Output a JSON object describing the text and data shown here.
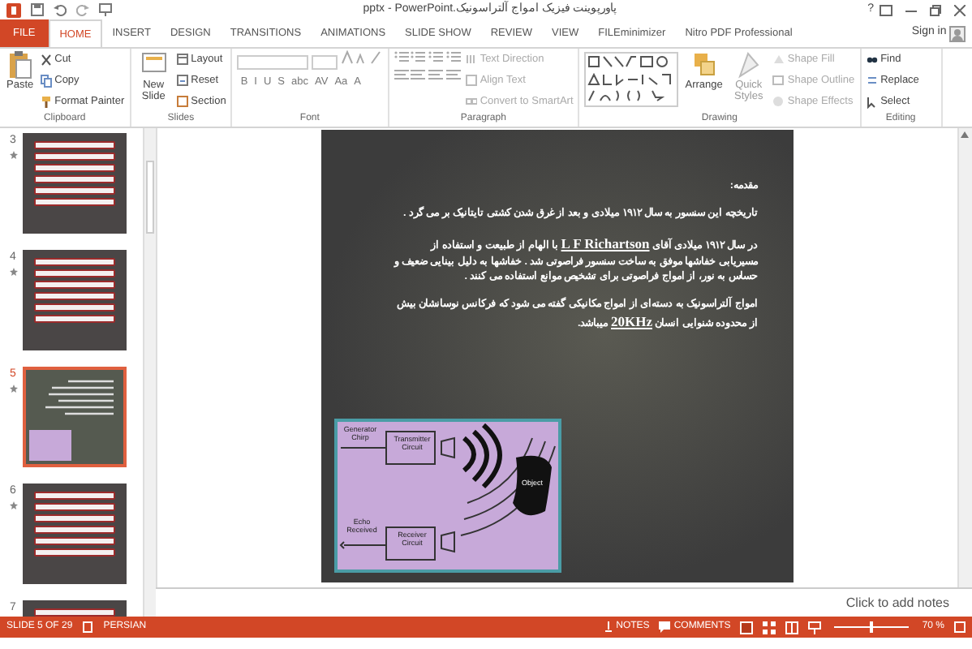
{
  "window": {
    "title": "پاورپوینت فیزیک امواج آلتراسونیک.pptx - PowerPoint",
    "help": "?"
  },
  "tabs": [
    {
      "label": "FILE",
      "kind": "file",
      "selected": false
    },
    {
      "label": "HOME",
      "kind": "tab",
      "selected": true
    },
    {
      "label": "INSERT",
      "kind": "tab",
      "selected": false
    },
    {
      "label": "DESIGN",
      "kind": "tab",
      "selected": false
    },
    {
      "label": "TRANSITIONS",
      "kind": "tab",
      "selected": false
    },
    {
      "label": "ANIMATIONS",
      "kind": "tab",
      "selected": false
    },
    {
      "label": "SLIDE SHOW",
      "kind": "tab",
      "selected": false
    },
    {
      "label": "REVIEW",
      "kind": "tab",
      "selected": false
    },
    {
      "label": "VIEW",
      "kind": "tab",
      "selected": false
    },
    {
      "label": "FILEminimizer",
      "kind": "tab",
      "selected": false
    },
    {
      "label": "Nitro PDF Professional",
      "kind": "tab",
      "selected": false
    }
  ],
  "sign_in": "Sign in",
  "ribbon": [
    {
      "name": "Clipboard",
      "kind": "clipboard",
      "big": [
        {
          "label": "Paste"
        }
      ],
      "items": [
        {
          "label": "Cut",
          "disabled": false
        },
        {
          "label": "Copy",
          "disabled": false
        },
        {
          "label": "Format Painter",
          "disabled": false
        }
      ]
    },
    {
      "name": "Slides",
      "kind": "slides",
      "big": [
        {
          "label": "New Slide"
        }
      ],
      "items": [
        {
          "label": "Layout",
          "disabled": false
        },
        {
          "label": "Reset",
          "disabled": false
        },
        {
          "label": "Section",
          "disabled": false
        }
      ]
    },
    {
      "name": "Font",
      "kind": "font",
      "buttons": [
        "B",
        "I",
        "U",
        "S",
        "abc",
        "AV",
        "Aa",
        "A"
      ]
    },
    {
      "name": "Paragraph",
      "kind": "paragraph",
      "items": [
        {
          "label": "Text Direction",
          "disabled": true
        },
        {
          "label": "Align Text",
          "disabled": true
        },
        {
          "label": "Convert to SmartArt",
          "disabled": true
        }
      ]
    },
    {
      "name": "Drawing",
      "kind": "drawing",
      "big": [
        {
          "label": "Arrange"
        },
        {
          "label": "Quick Styles"
        }
      ],
      "items": [
        {
          "label": "Shape Fill",
          "disabled": true
        },
        {
          "label": "Shape Outline",
          "disabled": true
        },
        {
          "label": "Shape Effects",
          "disabled": true
        }
      ]
    },
    {
      "name": "Editing",
      "kind": "editing",
      "items": [
        {
          "label": "Find",
          "disabled": false
        },
        {
          "label": "Replace",
          "disabled": false
        },
        {
          "label": "Select",
          "disabled": false
        }
      ]
    }
  ],
  "thumbnails": [
    {
      "number": "3",
      "kind": "menu",
      "selected": false
    },
    {
      "number": "4",
      "kind": "menu",
      "selected": false
    },
    {
      "number": "5",
      "kind": "content",
      "selected": true
    },
    {
      "number": "6",
      "kind": "menu",
      "selected": false
    },
    {
      "number": "7",
      "kind": "menu",
      "selected": false
    }
  ],
  "slide": {
    "heading": "مقدمه:",
    "paragraphs": [
      "تاریخچه این سنسور به سال ۱۹۱۲ میلادی و بعد از غرق شدن کشتی تایتانیک بر می گرد .",
      "در سال ۱۹۱۲ میلادی آقای **L F Richartson** با الهام از طبیعت و استفاده از مسیریابی خفاشها موفق به ساخت سنسور فراصوتی شد . خفاشها به دلیل بینایی ضعیف و حساس به نور، از امواج فراصوتی برای تشخیص موانع استفاده می کنند .",
      "امواج آلتراسونیک به دسته‌ای از امواج مکانیکی گفته می شود که فرکانس نوسانشان بیش از محدوده شنوایی انسان **20KHz** میباشد."
    ],
    "diagram": {
      "chirp": "Generator Chirp",
      "transmitter": "Transmitter Circuit",
      "echo": "Echo Received",
      "receiver": "Receiver Circuit",
      "object": "Object"
    }
  },
  "notes": {
    "placeholder": "Click to add notes"
  },
  "status_bar": {
    "slide": "SLIDE 5 OF 29",
    "language": "PERSIAN",
    "notes": "NOTES",
    "comments": "COMMENTS",
    "level": 0.5,
    "zoom": "70 %"
  }
}
